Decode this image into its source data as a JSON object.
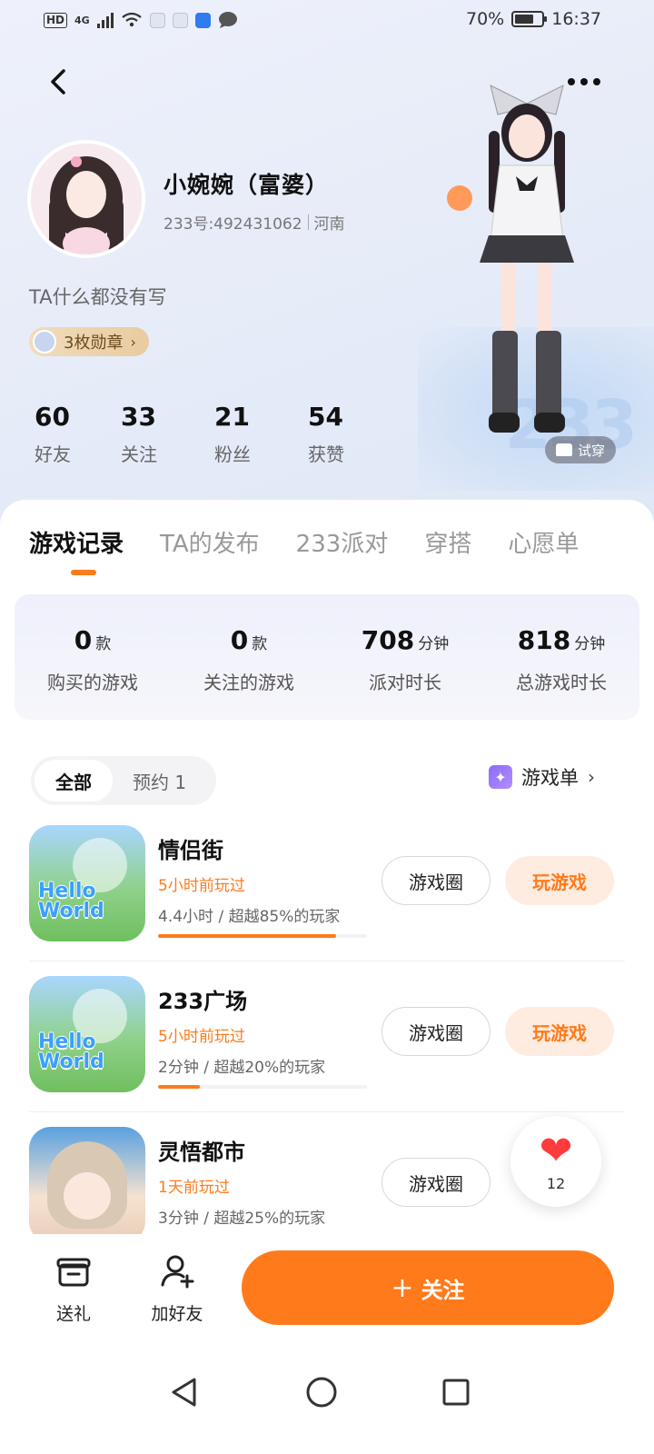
{
  "status_bar": {
    "hd": "HD",
    "network": "4G",
    "battery": "70%",
    "battery_level": 0.7,
    "time": "16:37"
  },
  "profile": {
    "nickname": "小婉婉（富婆）",
    "uid": "233号:492431062",
    "region": "河南",
    "bio": "TA什么都没有写",
    "badges_label": "3枚勋章",
    "stats": [
      {
        "value": "60",
        "label": "好友"
      },
      {
        "value": "33",
        "label": "关注"
      },
      {
        "value": "21",
        "label": "粉丝"
      },
      {
        "value": "54",
        "label": "获赞"
      }
    ],
    "try_on_label": "试穿",
    "hero_watermark": "233"
  },
  "tabs": [
    "游戏记录",
    "TA的发布",
    "233派对",
    "穿搭",
    "心愿单"
  ],
  "summary": [
    {
      "value": "0",
      "unit": "款",
      "label": "购买的游戏"
    },
    {
      "value": "0",
      "unit": "款",
      "label": "关注的游戏"
    },
    {
      "value": "708",
      "unit": "分钟",
      "label": "派对时长"
    },
    {
      "value": "818",
      "unit": "分钟",
      "label": "总游戏时长"
    }
  ],
  "filters": {
    "all": "全部",
    "preorder": "预约 1",
    "game_list": "游戏单"
  },
  "games": [
    {
      "title": "情侣街",
      "played": "5小时前玩过",
      "stat": "4.4小时 / 超越85%的玩家",
      "percentile": 0.85,
      "icon_text": "Hello World",
      "circle_btn": "游戏圈",
      "play_btn": "玩游戏"
    },
    {
      "title": "233广场",
      "played": "5小时前玩过",
      "stat": "2分钟 / 超越20%的玩家",
      "percentile": 0.2,
      "icon_text": "Hello World",
      "circle_btn": "游戏圈",
      "play_btn": "玩游戏"
    },
    {
      "title": "灵悟都市",
      "played": "1天前玩过",
      "stat": "3分钟 / 超越25%的玩家",
      "percentile": 0.25,
      "circle_btn": "游戏圈"
    }
  ],
  "like_float": {
    "count": "12"
  },
  "bottom_bar": {
    "gift": "送礼",
    "add_friend": "加好友",
    "follow": "关注"
  },
  "colors": {
    "accent": "#ff7a1a",
    "heart": "#ff3b3b"
  }
}
